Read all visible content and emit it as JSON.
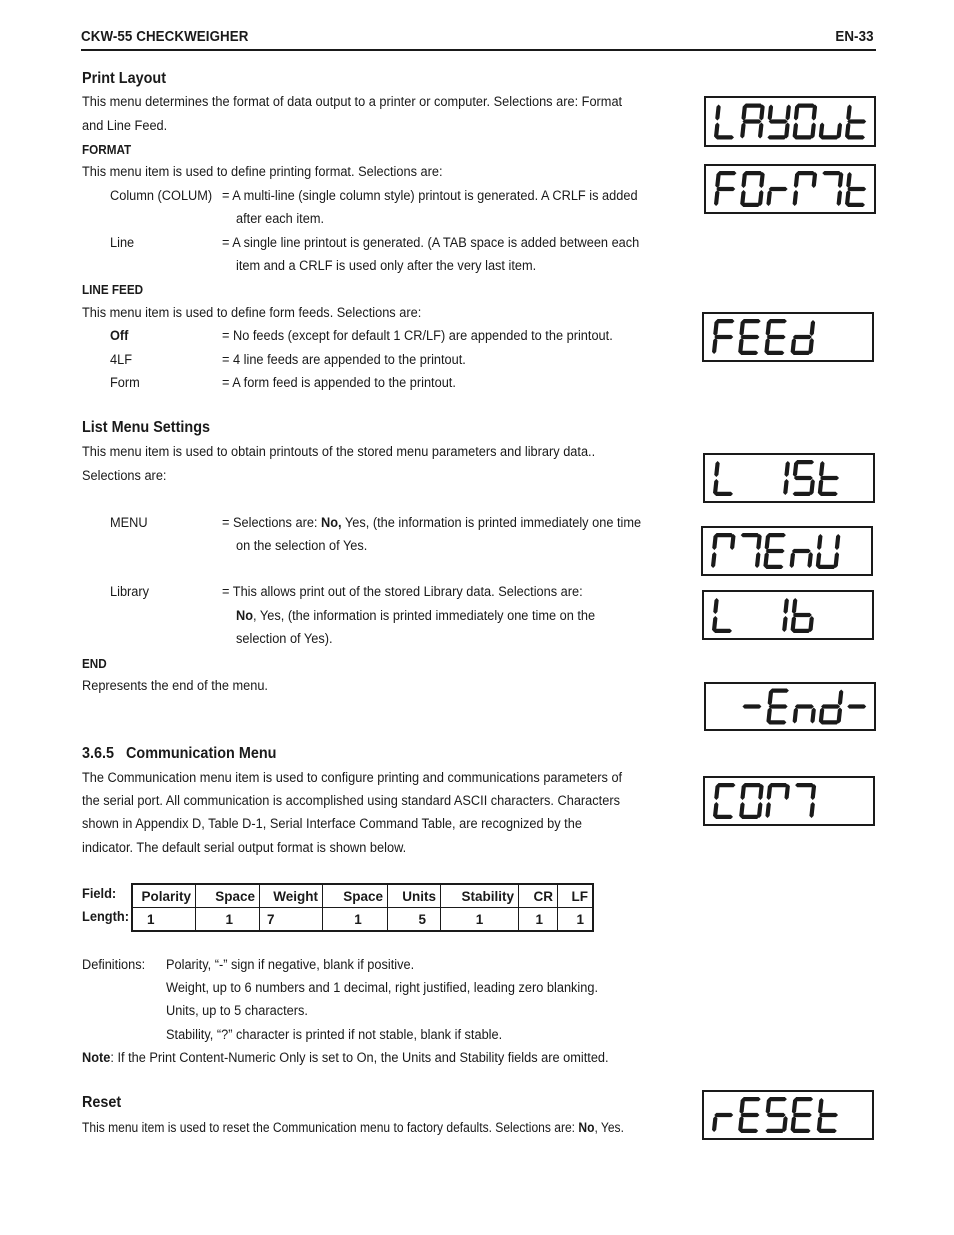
{
  "header": {
    "title": "CKW-55 CHECKWEIGHER",
    "page": "EN-33"
  },
  "print_layout": {
    "heading": "Print Layout",
    "intro_lines": [
      "This menu determines the format of data output to a printer or computer.  Selections are: Format",
      "and Line Feed."
    ],
    "format": {
      "heading": "FORMAT",
      "intro": "This menu item is used to define printing format.  Selections are:",
      "items": [
        {
          "term": "Column (COLUM)",
          "desc": [
            "= A multi-line (single column style) printout is generated.  A CRLF is added",
            "after each item."
          ]
        },
        {
          "term": "Line",
          "desc": [
            "= A single line printout is generated.  (A TAB space is added between each",
            "item and a CRLF is used only after the very last item."
          ]
        }
      ]
    },
    "line_feed": {
      "heading": "LINE FEED",
      "intro": "This menu item is used to define form feeds.  Selections are:",
      "items": [
        {
          "term": "Off",
          "bold": true,
          "desc": "= No feeds (except for default 1 CR/LF) are appended to the printout."
        },
        {
          "term": "4LF",
          "desc": "= 4 line feeds are appended to the printout."
        },
        {
          "term": "Form",
          "desc": "= A form feed is appended to the printout."
        }
      ]
    }
  },
  "list_menu": {
    "heading": "List Menu Settings",
    "intro_lines": [
      "This menu item is used to obtain printouts of the stored menu parameters and library data..",
      "Selections are:"
    ],
    "menu": {
      "term": "MENU",
      "desc_prefix": "= Selections are: ",
      "desc_bold": "No,",
      "desc_suffix": " Yes, (the information is printed immediately one time",
      "desc_line2": "on the selection of Yes."
    },
    "library": {
      "term": "Library",
      "desc_line1": "= This allows print out of the stored Library data.  Selections are:",
      "desc_bold": "No",
      "desc_line2_suffix": ", Yes, (the information is printed immediately one time on the",
      "desc_line3": "selection of Yes)."
    },
    "end": {
      "heading": "END",
      "text": "Represents the end of the menu."
    }
  },
  "communication": {
    "heading": "3.6.5   Communication Menu",
    "intro_lines": [
      "The Communication menu item is used to configure printing and communications parameters of",
      "the serial port.  All communication is accomplished using standard ASCII characters.  Characters",
      "shown in Appendix D, Table D-1, Serial Interface Command Table, are recognized by the",
      "indicator.  The default serial output format is shown below."
    ],
    "format_table": {
      "field_label": "Field:",
      "length_label": "Length:",
      "fields": [
        "Polarity",
        "Space",
        "Weight",
        "Space",
        "Units",
        "Stability",
        "CR",
        "LF"
      ],
      "lengths": [
        "1",
        "1",
        "7",
        "1",
        "5",
        "1",
        "1",
        "1"
      ]
    },
    "definitions": {
      "label": "Definitions:",
      "lines": [
        "Polarity, “-” sign if negative, blank if positive.",
        "Weight, up to 6 numbers and 1 decimal, right justified, leading zero blanking.",
        "Units, up to 5 characters.",
        "Stability, “?” character is printed if not stable, blank if stable."
      ]
    },
    "note": {
      "label": "Note",
      "text": ": If the Print Content-Numeric Only is set to On, the Units and Stability fields are omitted."
    },
    "reset": {
      "heading": "Reset",
      "text_prefix": "This menu item is used to reset the Communication menu to factory defaults. Selections are: ",
      "text_bold": "No",
      "text_suffix": ", Yes."
    }
  },
  "displays": {
    "layout": "LAYOUT",
    "format": "FORMAT",
    "feed": "FEED",
    "list": "LIST",
    "menu": "MENU",
    "lib": "LIB",
    "end": "-END-",
    "comm": "COMM",
    "reset": "RESET"
  },
  "display_glyphs": {
    "layout": [
      "L",
      "A",
      "y",
      "O",
      "u",
      "t"
    ],
    "format": [
      "F",
      "O",
      "r",
      "M1",
      "M2",
      "t"
    ],
    "feed": [
      "F",
      "E",
      "E",
      "d"
    ],
    "list": [
      "L",
      " ",
      "1",
      "5",
      "t"
    ],
    "menu": [
      "M1",
      "M2",
      "E",
      "n",
      "U"
    ],
    "lib": [
      "L",
      " ",
      "1",
      "b"
    ],
    "end": [
      " ",
      "-",
      "E",
      "n",
      "d",
      "-"
    ],
    "comm": [
      "C",
      "O",
      "M1",
      "M2"
    ],
    "reset": [
      "r",
      "E",
      "5",
      "E",
      "t"
    ]
  }
}
